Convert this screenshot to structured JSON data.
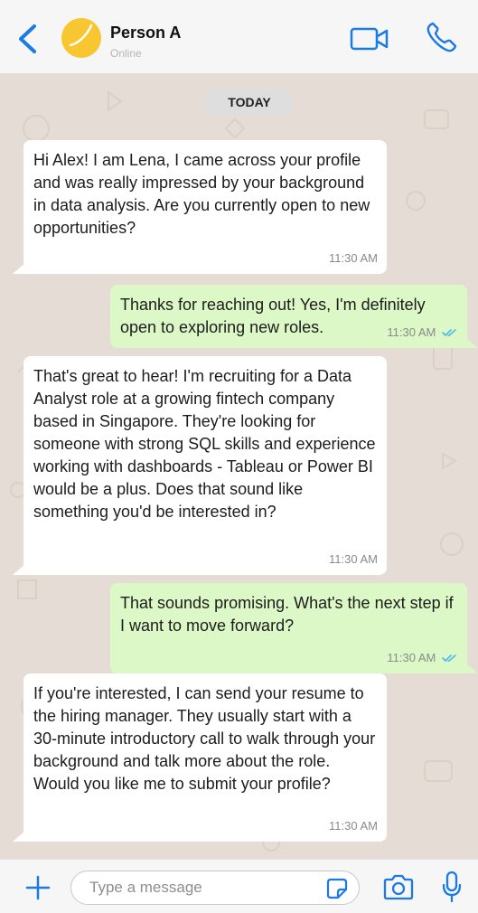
{
  "header": {
    "contact_name": "Person A",
    "status": "Online",
    "icons": {
      "back": "chevron-left-icon",
      "video": "video-camera-icon",
      "phone": "phone-icon"
    }
  },
  "chat": {
    "date_label": "TODAY",
    "messages": [
      {
        "direction": "incoming",
        "text": "Hi Alex! I am Lena, I came across your profile and was really impressed by your background in data analysis. Are you currently open to new opportunities?",
        "time": "11:30 AM"
      },
      {
        "direction": "outgoing",
        "text": "Thanks for reaching out! Yes, I'm definitely open to exploring new roles.",
        "time": "11:30 AM",
        "read": true
      },
      {
        "direction": "incoming",
        "text": "That's great to hear! I'm recruiting for a Data Analyst role at a growing fintech company based in Singapore. They're looking for someone with strong SQL skills and experience working with dashboards - Tableau or Power BI would be a plus. Does that sound like something you'd be interested in?",
        "time": "11:30 AM"
      },
      {
        "direction": "outgoing",
        "text": "That sounds promising. What's the next step if I want to move forward?",
        "time": "11:30 AM",
        "read": true
      },
      {
        "direction": "incoming",
        "text": "If you're interested, I can send your resume to the hiring manager. They usually start with a 30-minute introductory call to walk through your background and talk more about the role. Would you like me to submit your profile?",
        "time": "11:30 AM"
      }
    ]
  },
  "input_bar": {
    "placeholder": "Type a message",
    "value": "",
    "icons": {
      "add": "plus-icon",
      "sticker": "sticker-icon",
      "camera": "camera-icon",
      "mic": "microphone-icon"
    }
  },
  "colors": {
    "accent": "#1a7ae6",
    "chat_background": "#e5ddd5",
    "incoming_bubble": "#ffffff",
    "outgoing_bubble": "#dcf8c6",
    "read_ticks": "#4fb6ec",
    "avatar": "#f8c630"
  }
}
